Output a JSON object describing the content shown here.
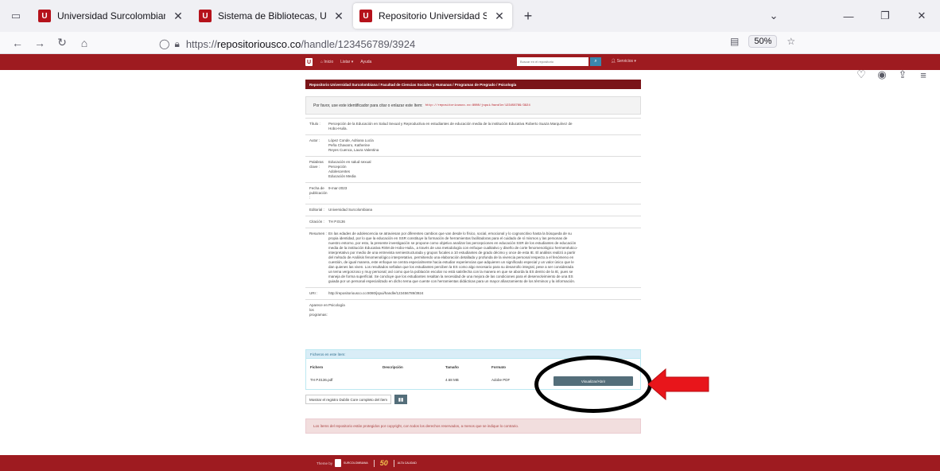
{
  "browser": {
    "tabs": [
      {
        "title": "Universidad Surcolombiana",
        "active": false
      },
      {
        "title": "Sistema de Bibliotecas, Universi",
        "active": false
      },
      {
        "title": "Repositorio Universidad Surcolo",
        "active": true
      }
    ],
    "url_scheme": "https://",
    "url_host": "repositoriousco.co",
    "url_path": "/handle/123456789/3924",
    "zoom": "50%"
  },
  "site": {
    "nav": {
      "home": "Inicio",
      "list": "Listar ▾",
      "help": "Ayuda",
      "search_placeholder": "Buscar en el repositorio",
      "services": "Servicios ▾"
    },
    "breadcrumb": "Repositorio Universidad Surcolombiana  /  Facultad de Ciencias Sociales y Humanas  /  Programas de Pregrado  /  Psicología",
    "cite_text": "Por favor, use este identificador para citar o enlazar este ítem:",
    "cite_url": "http://repositoriousco.co:8080/jspui/handle/123456789/3924",
    "metadata": [
      {
        "label": "Título :",
        "lines": [
          "Percepción de la Educación en Salud Sexual y Reproductiva en estudiantes de educación media de la institución Educativa Roberto Suaza Marquínez de",
          "Hobo-Huila."
        ]
      },
      {
        "label": "Autor :",
        "lines": [
          "López Conde, Adriana Lucía",
          "Peña Chavarro, Katherine",
          "Reyes Cuenca, Laura Valentina"
        ]
      },
      {
        "label": "Palabras clave :",
        "lines": [
          "Educación en salud sexual",
          "Percepción",
          "Adolescentes",
          "Educación Media"
        ]
      },
      {
        "label": "Fecha de publicación :",
        "lines": [
          "9-mar-2023"
        ]
      },
      {
        "label": "Editorial :",
        "lines": [
          "Universidad Surcolombiana"
        ]
      },
      {
        "label": "Citación :",
        "lines": [
          "TH P.0136"
        ]
      },
      {
        "label": "Resumen :",
        "lines": [
          "En las edades de adolescencia se atraviesan por diferentes cambios que van desde lo físico, social, emocional y lo cognoscitivo hasta la búsqueda de su",
          "propia identidad, por lo que la educación en SSR constituye la formación de herramientas facilitadoras para el cuidado de sí mismos y las personas de",
          "nuestro entorno, por esto, la presente investigación se propone como objetivo analizar las percepciones en educación SSR de los estudiantes de educación",
          "media de la institución Educativa RSM de Hobo-Huila., a través de una metodología con enfoque cualitativo y diseño de corte fenomenológico hermenéutico-",
          "interpretativo por medio de una entrevista semiestructurada y grupos focales a 10 estudiantes de grado décimo y once de esta IE. El análisis realizó a partir",
          "del método de Análisis fenomenológico interpretativo, permitiendo una elaboración detallada y profunda de la vivencia personal respecto a el fenómeno en",
          "cuestión, de igual manera, este enfoque se centra especialmente hacia estudiar experiencias que adquieren un significado especial y un valor único que le",
          "dan quienes las viven. Los resultados señalan que los estudiantes perciben la ES como algo necesario para su desarrollo integral, pese a ser considerada",
          "un tema vergonzoso y muy personal; así como que la población escolar no está satisfecha con la manera en que se aborda la ES dentro de la IE, pues se",
          "maneja de forma superficial. Se concluye que los estudiantes resaltan la necesidad de una mejora de las condiciones para el desenvolvimiento de una ES",
          "guiada por un personal especializado en dicho tema que cuente con herramientas didácticas para un mayor afianzamiento de los términos y la información."
        ]
      },
      {
        "label": "URI :",
        "lines": [
          "http://repositoriousco.co:8080/jspui/handle/123456789/3924"
        ]
      },
      {
        "label": "Aparece en los programas:",
        "lines": [
          "Psicología"
        ]
      }
    ],
    "files": {
      "heading": "Ficheros en este ítem:",
      "columns": [
        "Fichero",
        "Descripción",
        "Tamaño",
        "Formato"
      ],
      "rows": [
        {
          "file": "TH P.0136.pdf",
          "description": "",
          "size": "4.68 MB",
          "format": "Adobe PDF",
          "action": "Visualizar/Abrir"
        }
      ]
    },
    "dublin_core_button": "Mostrar el registro Dublin Core completo del ítem",
    "rights": "Los ítems del repositorio están protegidos por copyright, con todos los derechos reservados, a menos que se indique lo contrario.",
    "footer": {
      "theme_by": "Theme by",
      "univ": "SURCOLOMBIANA",
      "anniversary": "50",
      "quality": "ALTA CALIDAD"
    }
  },
  "colors": {
    "brand_red": "#9e1b20",
    "annotation_arrow": "#e8151b",
    "annotation_ring": "#000000"
  }
}
